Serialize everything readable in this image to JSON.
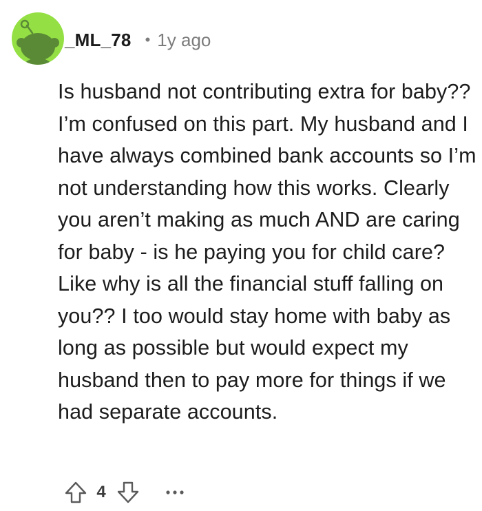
{
  "comment": {
    "author": "_ML_78",
    "separator": "•",
    "timestamp": "1y ago",
    "body": "Is husband not contributing extra for baby?? I’m confused on this part. My husband and I have always combined bank accounts so I’m not understanding how this works. Clearly you aren’t making as much AND are caring for baby - is he paying you for child care? Like why is all the financial stuff falling on you?? I too would stay home with baby as long as possible but would expect my husband then to pay more for things if we had separate accounts.",
    "score": "4"
  },
  "icons": {
    "avatar": "reddit-snoo-avatar",
    "upvote": "upvote-arrow-icon",
    "downvote": "downvote-arrow-icon",
    "more": "more-options-icon"
  },
  "colors": {
    "avatar_bg": "#94e044",
    "snoo_body": "#5a8a36",
    "text": "#1c1c1c",
    "meta": "#7c7c7c",
    "icon": "#5a5a5a"
  }
}
